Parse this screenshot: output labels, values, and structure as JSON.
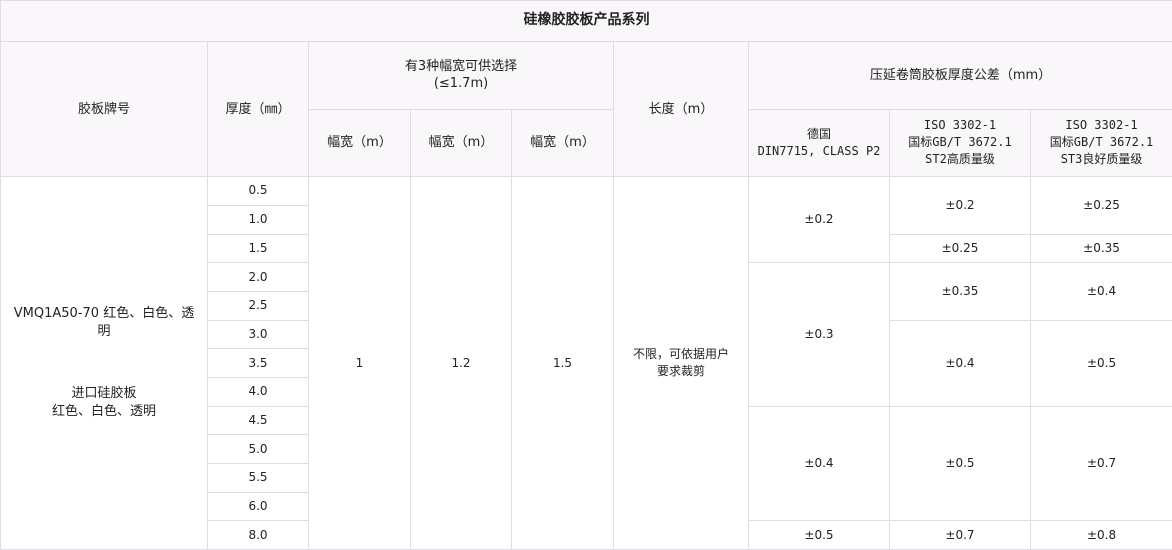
{
  "title": "硅橡胶胶板产品系列",
  "headers": {
    "brand": "胶板牌号",
    "thickness": "厚度（㎜）",
    "widths_group_line1": "有3种幅宽可供选择",
    "widths_group_line2": "(≤1.7m)",
    "width_label": "幅宽（m）",
    "length": "长度（m）",
    "tolerance_group": "压延卷筒胶板厚度公差（mm）",
    "std1_line1": "德国",
    "std1_line2": "DIN7715, CLASS P2",
    "std2_line1": "ISO 3302-1",
    "std2_line2": "国标GB/T 3672.1",
    "std2_line3": "ST2高质量级",
    "std3_line1": "ISO 3302-1",
    "std3_line2": "国标GB/T 3672.1",
    "std3_line3": "ST3良好质量级"
  },
  "brand": {
    "line1": "VMQ1A50-70 红色、白色、透",
    "line2": "明",
    "line3": "进口硅胶板",
    "line4": "红色、白色、透明"
  },
  "thicknesses": [
    "0.5",
    "1.0",
    "1.5",
    "2.0",
    "2.5",
    "3.0",
    "3.5",
    "4.0",
    "4.5",
    "5.0",
    "5.5",
    "6.0",
    "8.0"
  ],
  "widths": [
    "1",
    "1.2",
    "1.5"
  ],
  "length": {
    "line1": "不限，可依据用户",
    "line2": "要求裁剪"
  },
  "din": [
    "±0.2",
    "±0.3",
    "±0.4",
    "±0.5"
  ],
  "st2": [
    "±0.2",
    "±0.25",
    "±0.35",
    "±0.4",
    "±0.5",
    "±0.7"
  ],
  "st3": [
    "±0.25",
    "±0.35",
    "±0.4",
    "±0.5",
    "±0.7",
    "±0.8"
  ]
}
